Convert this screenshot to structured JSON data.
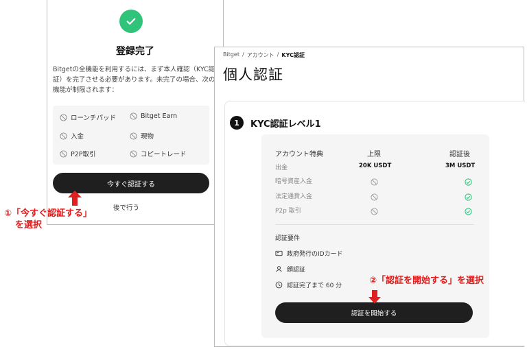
{
  "left": {
    "title": "登録完了",
    "description": "Bitgetの全機能を利用するには、まず本人確認（KYC認証）を完了させる必要があります。未完了の場合、次の機能が制限されます：",
    "restrictions": [
      "ローンチパッド",
      "Bitget Earn",
      "入金",
      "現物",
      "P2P取引",
      "コピートレード"
    ],
    "verify_now_label": "今すぐ認証する",
    "later_label": "後で行う"
  },
  "right": {
    "breadcrumb": [
      "Bitget",
      "/",
      "アカウント",
      "/",
      "KYC認証"
    ],
    "page_title": "個人認証",
    "step_number": "1",
    "level_title": "KYC認証レベル1",
    "table": {
      "headers": [
        "アカウント特典",
        "上限",
        "認証後"
      ],
      "rows": [
        {
          "label": "出金",
          "limit": "20K USDT",
          "after": "3M USDT"
        },
        {
          "label": "暗号資産入金",
          "limit_icon": "ban-icon",
          "after_icon": "check-circle-icon"
        },
        {
          "label": "法定通貨入金",
          "limit_icon": "ban-icon",
          "after_icon": "check-circle-icon"
        },
        {
          "label": "P2p 取引",
          "limit_icon": "ban-icon",
          "after_icon": "check-circle-icon"
        }
      ]
    },
    "requirements_title": "認証要件",
    "requirements": [
      {
        "icon": "id-card-icon",
        "text": "政府発行のIDカード"
      },
      {
        "icon": "user-icon",
        "text": "顔認証"
      },
      {
        "icon": "clock-icon",
        "text": "認証完了まで 60 分"
      }
    ],
    "start_label": "認証を開始する"
  },
  "annotations": {
    "note1_line1": "①「今すぐ認証する」",
    "note1_line2": "を選択",
    "note2": "②「認証を開始する」を選択"
  },
  "colors": {
    "accent_green": "#2fc47a",
    "button_dark": "#1f1f1f",
    "annotation_red": "#e02020"
  }
}
